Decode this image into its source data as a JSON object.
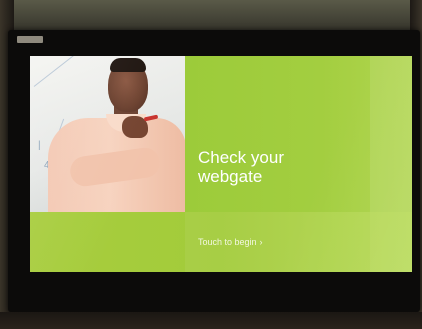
{
  "screen": {
    "headline_line1": "Check your",
    "headline_line2": "webgate",
    "cta_label": "Touch to begin",
    "cta_chevron": "›"
  },
  "colors": {
    "screen_green": "#9fc83a",
    "text": "#ffffff"
  }
}
